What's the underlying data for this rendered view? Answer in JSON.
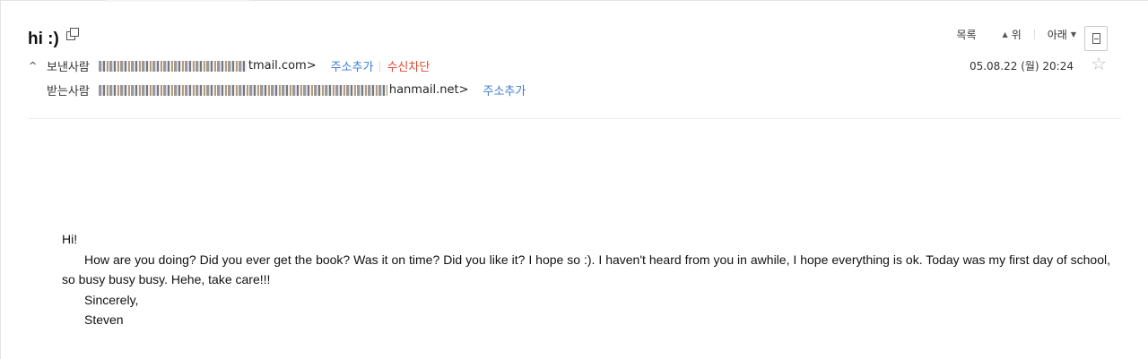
{
  "subject": "hi :)",
  "from": {
    "label": "보낸사람",
    "address_visible": "tmail.com>",
    "add_contact": "주소추가",
    "block": "수신차단"
  },
  "to": {
    "label": "받는사람",
    "address_visible": "hanmail.net>",
    "add_contact": "주소추가"
  },
  "toolbar": {
    "list": "목록",
    "up": "위",
    "down": "아래"
  },
  "date": "05.08.22 (월) 20:24",
  "body": {
    "greeting": "Hi!",
    "paragraph": "How are you doing?  Did you ever get the book?  Was it on time?  Did you like it?  I hope so :).  I haven't heard from you in awhile, I hope everything is ok.  Today was my first day of school, so busy busy busy.  Hehe, take care!!!",
    "closing": "Sincerely,",
    "signature": "Steven"
  },
  "icons": {
    "copy": "copy-icon",
    "collapse": "chevron-up-icon",
    "print": "print-icon",
    "star": "star-icon"
  }
}
